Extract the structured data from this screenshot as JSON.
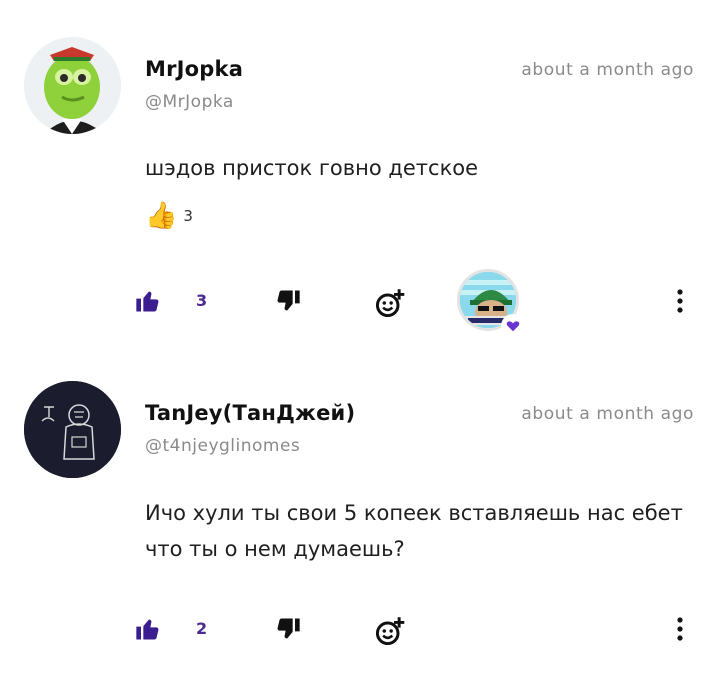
{
  "comments": [
    {
      "author": "MrJopka",
      "handle": "@MrJopka",
      "time": "about a month ago",
      "text": "шэдов присток говно детское",
      "reaction": {
        "emoji": "👍",
        "count": "3"
      },
      "likes": "3"
    },
    {
      "author": "TanJey(ТанДжей)",
      "handle": "@t4njeyglinomes",
      "time": "about a month ago",
      "text": "Ичо хули ты свои 5 копеек вставляешь нас ебет что ты о нем думаешь?",
      "likes": "2"
    }
  ],
  "colors": {
    "accent": "#4a2a8f",
    "heart": "#6a34d1",
    "muted": "#8a8a8a"
  },
  "icons": [
    "thumbs-up-icon",
    "thumbs-down-icon",
    "add-reaction-icon",
    "more-vertical-icon",
    "heart-icon"
  ]
}
